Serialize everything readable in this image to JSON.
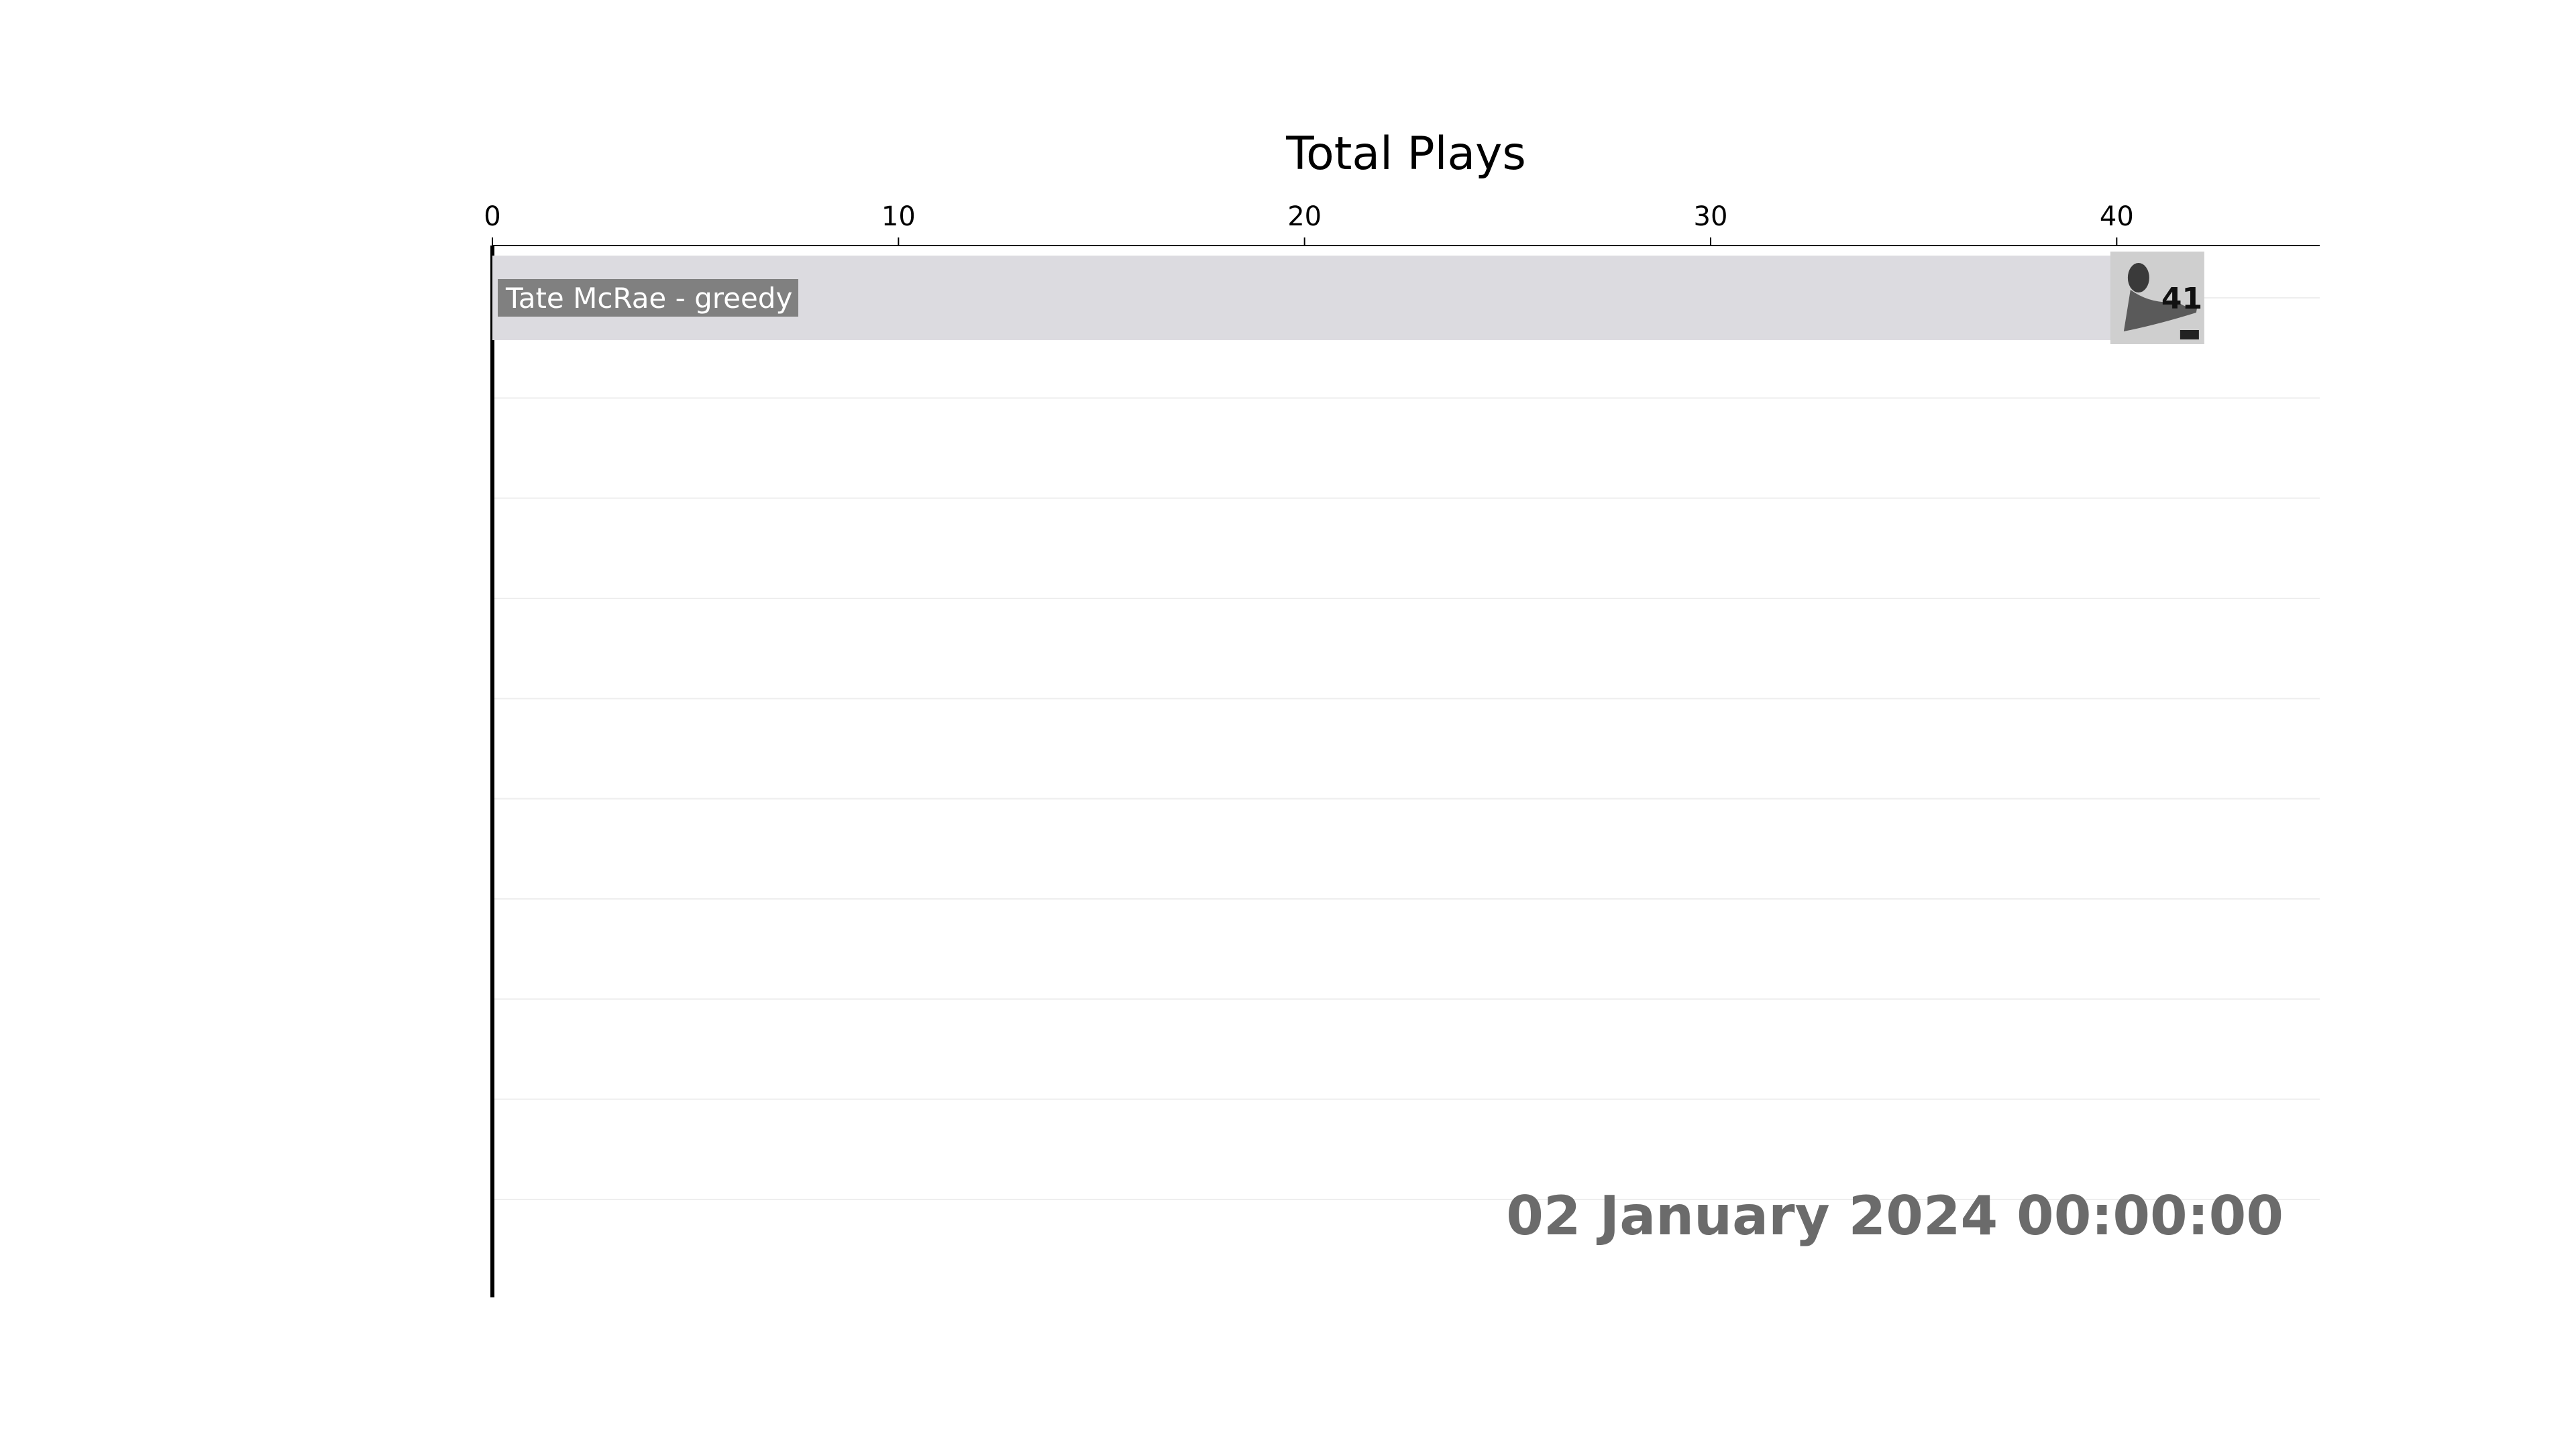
{
  "chart_data": {
    "type": "bar",
    "orientation": "horizontal",
    "title": "Total Plays",
    "xlabel": "",
    "ylabel": "",
    "xlim": [
      0,
      45
    ],
    "x_ticks": [
      0,
      10,
      20,
      30,
      40
    ],
    "x_axis_position": "top",
    "grid": true,
    "rank_slots": 10,
    "categories": [
      "Tate McRae - greedy"
    ],
    "values": [
      41
    ],
    "value_labels": [
      "41"
    ],
    "timestamp": "02 January 2024 00:00:00",
    "colors": {
      "bar": "#dcdbe0",
      "label_box": "#808080",
      "timestamp": "#6b6b6b",
      "grid": "#eeeeee",
      "axis": "#000000"
    },
    "icons": [
      "album-cover-thumbnail"
    ]
  }
}
